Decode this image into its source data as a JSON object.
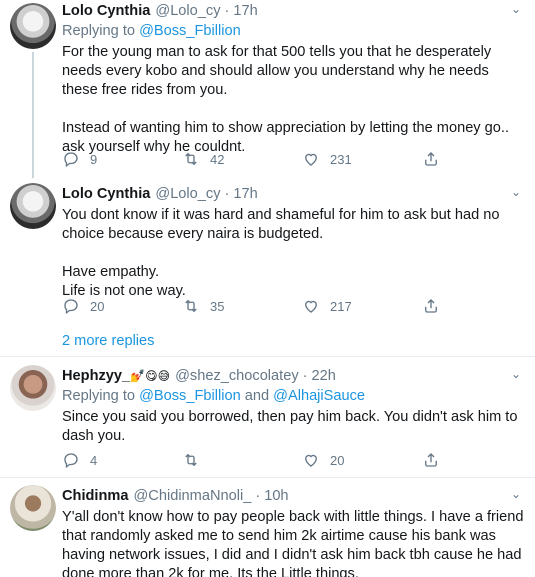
{
  "tweets": [
    {
      "name": "Lolo Cynthia",
      "handle": "@Lolo_cy",
      "time": "17h",
      "replying_prefix": "Replying to ",
      "replying_to": "@Boss_Fbillion",
      "text": "For the young man to ask for that 500 tells you that he desperately needs every kobo and should allow you understand why he needs these free rides from you.\n\nInstead of wanting him to show appreciation by letting the money go.. ask yourself why he couldnt.",
      "replies": "9",
      "retweets": "42",
      "likes": "231"
    },
    {
      "name": "Lolo Cynthia",
      "handle": "@Lolo_cy",
      "time": "17h",
      "text": "You dont know if it was hard and shameful for him to ask but had no choice because every naira is budgeted.\n\nHave empathy.\nLife is not one way.",
      "replies": "20",
      "retweets": "35",
      "likes": "217"
    },
    {
      "name": "Hephzyy_",
      "name_emojis": "💅😋😅",
      "handle": "@shez_chocolatey",
      "time": "22h",
      "replying_prefix": "Replying to ",
      "replying_to": "@Boss_Fbillion",
      "replying_and": " and ",
      "replying_to_2": "@AlhajiSauce",
      "text": "Since you said you borrowed, then pay him back. You didn't ask him to dash you.",
      "replies": "4",
      "retweets": "",
      "likes": "20"
    },
    {
      "name": "Chidinma",
      "handle": "@ChidinmaNnoli_",
      "time": "10h",
      "text": "Y'all don't know how to pay people back with little things. I have a friend that randomly asked me to send him 2k airtime cause his bank was having network issues, I did and I didn't ask him back tbh cause he had done more than 2k for me. Its the Little things."
    }
  ],
  "more_replies": "2 more replies",
  "separator": "·",
  "icons": [
    "reply-icon",
    "retweet-icon",
    "like-icon",
    "share-icon",
    "chevron-down-icon"
  ]
}
